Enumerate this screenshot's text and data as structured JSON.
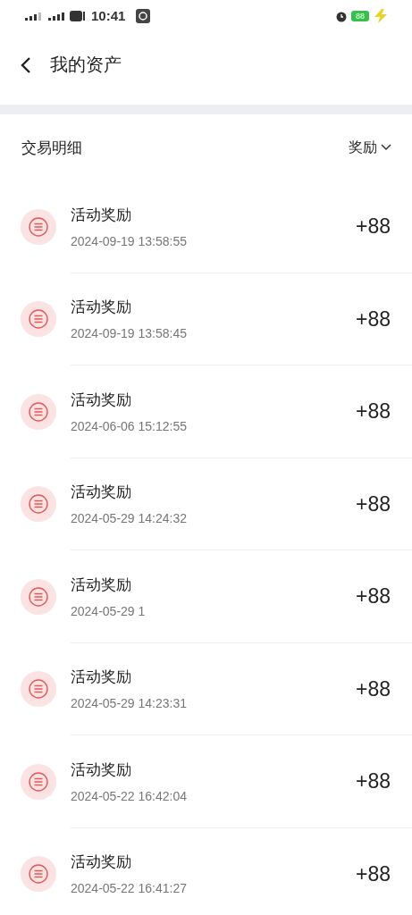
{
  "status_bar": {
    "time": "10:41",
    "battery": "88"
  },
  "header": {
    "title": "我的资产"
  },
  "section": {
    "title": "交易明细",
    "filter": "奖励"
  },
  "transactions": [
    {
      "title": "活动奖励",
      "time": "2024-09-19 13:58:55",
      "amount": "+88"
    },
    {
      "title": "活动奖励",
      "time": "2024-09-19 13:58:45",
      "amount": "+88"
    },
    {
      "title": "活动奖励",
      "time": "2024-06-06 15:12:55",
      "amount": "+88"
    },
    {
      "title": "活动奖励",
      "time": "2024-05-29 14:24:32",
      "amount": "+88"
    },
    {
      "title": "活动奖励",
      "time": "2024-05-29 1",
      "amount": "+88"
    },
    {
      "title": "活动奖励",
      "time": "2024-05-29 14:23:31",
      "amount": "+88"
    },
    {
      "title": "活动奖励",
      "time": "2024-05-22 16:42:04",
      "amount": "+88"
    },
    {
      "title": "活动奖励",
      "time": "2024-05-22 16:41:27",
      "amount": "+88"
    }
  ]
}
